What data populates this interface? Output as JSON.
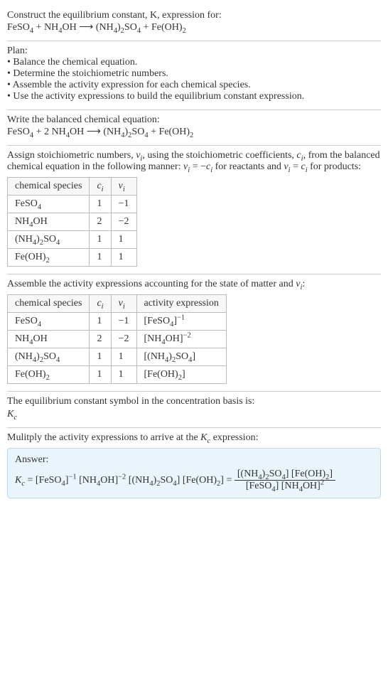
{
  "intro": {
    "line1": "Construct the equilibrium constant, K, expression for:"
  },
  "equation_unbalanced": {
    "r1": "FeSO",
    "r1s": "4",
    "plus1": " + ",
    "r2": "NH",
    "r2s": "4",
    "r2b": "OH",
    "arrow": " ⟶ ",
    "p1a": "(NH",
    "p1as": "4",
    "p1b": ")",
    "p1bs": "2",
    "p1c": "SO",
    "p1cs": "4",
    "plus2": " + ",
    "p2": "Fe(OH)",
    "p2s": "2"
  },
  "plan": {
    "heading": "Plan:",
    "items": [
      "Balance the chemical equation.",
      "Determine the stoichiometric numbers.",
      "Assemble the activity expression for each chemical species.",
      "Use the activity expressions to build the equilibrium constant expression."
    ]
  },
  "balanced": {
    "heading": "Write the balanced chemical equation:",
    "coef_r2": "2 "
  },
  "stoich": {
    "text_a": "Assign stoichiometric numbers, ",
    "nu": "ν",
    "nu_sub": "i",
    "text_b": ", using the stoichiometric coefficients, ",
    "c": "c",
    "c_sub": "i",
    "text_c": ", from the balanced chemical equation in the following manner: ",
    "rel1a": "ν",
    "rel1b": " = −",
    "rel1c": "c",
    "text_d": " for reactants and ",
    "rel2a": "ν",
    "rel2b": " = ",
    "rel2c": "c",
    "text_e": " for products:",
    "headers": {
      "h1": "chemical species",
      "h2": "c",
      "h2s": "i",
      "h3": "ν",
      "h3s": "i"
    },
    "rows": [
      {
        "sp_a": "FeSO",
        "sp_as": "4",
        "sp_b": "",
        "sp_bs": "",
        "sp_c": "",
        "sp_cs": "",
        "c": "1",
        "nu": "−1"
      },
      {
        "sp_a": "NH",
        "sp_as": "4",
        "sp_b": "OH",
        "sp_bs": "",
        "sp_c": "",
        "sp_cs": "",
        "c": "2",
        "nu": "−2"
      },
      {
        "sp_a": "(NH",
        "sp_as": "4",
        "sp_b": ")",
        "sp_bs": "2",
        "sp_c": "SO",
        "sp_cs": "4",
        "c": "1",
        "nu": "1"
      },
      {
        "sp_a": "Fe(OH)",
        "sp_as": "2",
        "sp_b": "",
        "sp_bs": "",
        "sp_c": "",
        "sp_cs": "",
        "c": "1",
        "nu": "1"
      }
    ]
  },
  "activity": {
    "heading_a": "Assemble the activity expressions accounting for the state of matter and ",
    "heading_b": ":",
    "headers": {
      "h1": "chemical species",
      "h2": "c",
      "h2s": "i",
      "h3": "ν",
      "h3s": "i",
      "h4": "activity expression"
    },
    "rows": [
      {
        "sp_a": "FeSO",
        "sp_as": "4",
        "sp_b": "",
        "sp_bs": "",
        "sp_c": "",
        "sp_cs": "",
        "c": "1",
        "nu": "−1",
        "ae_a": "[FeSO",
        "ae_as": "4",
        "ae_b": "]",
        "ae_bs": "",
        "ae_c": "",
        "ae_cs": "",
        "ae_exp": "−1"
      },
      {
        "sp_a": "NH",
        "sp_as": "4",
        "sp_b": "OH",
        "sp_bs": "",
        "sp_c": "",
        "sp_cs": "",
        "c": "2",
        "nu": "−2",
        "ae_a": "[NH",
        "ae_as": "4",
        "ae_b": "OH]",
        "ae_bs": "",
        "ae_c": "",
        "ae_cs": "",
        "ae_exp": "−2"
      },
      {
        "sp_a": "(NH",
        "sp_as": "4",
        "sp_b": ")",
        "sp_bs": "2",
        "sp_c": "SO",
        "sp_cs": "4",
        "c": "1",
        "nu": "1",
        "ae_a": "[(NH",
        "ae_as": "4",
        "ae_b": ")",
        "ae_bs": "2",
        "ae_c": "SO",
        "ae_cs": "4",
        "ae_d": "]",
        "ae_exp": ""
      },
      {
        "sp_a": "Fe(OH)",
        "sp_as": "2",
        "sp_b": "",
        "sp_bs": "",
        "sp_c": "",
        "sp_cs": "",
        "c": "1",
        "nu": "1",
        "ae_a": "[Fe(OH)",
        "ae_as": "2",
        "ae_b": "]",
        "ae_bs": "",
        "ae_c": "",
        "ae_cs": "",
        "ae_exp": ""
      }
    ]
  },
  "ksymbol": {
    "line1": "The equilibrium constant symbol in the concentration basis is:",
    "K": "K",
    "Ks": "c"
  },
  "final": {
    "heading": "Mulitply the activity expressions to arrive at the ",
    "heading_b": " expression:",
    "answer_label": "Answer:",
    "eq": " = ",
    "lhs_K": "K",
    "lhs_Ks": "c",
    "t1a": "[FeSO",
    "t1as": "4",
    "t1b": "]",
    "t1exp": "−1",
    "sp": " ",
    "t2a": "[NH",
    "t2as": "4",
    "t2b": "OH]",
    "t2exp": "−2",
    "t3a": "[(NH",
    "t3as": "4",
    "t3b": ")",
    "t3bs": "2",
    "t3c": "SO",
    "t3cs": "4",
    "t3d": "]",
    "t4a": "[Fe(OH)",
    "t4as": "2",
    "t4b": "]",
    "eq2": " = ",
    "num_a": "[(NH",
    "num_as": "4",
    "num_b": ")",
    "num_bs": "2",
    "num_c": "SO",
    "num_cs": "4",
    "num_d": "] [Fe(OH)",
    "num_ds": "2",
    "num_e": "]",
    "den_a": "[FeSO",
    "den_as": "4",
    "den_b": "] [NH",
    "den_bs": "4",
    "den_c": "OH]",
    "den_exp": "2"
  }
}
